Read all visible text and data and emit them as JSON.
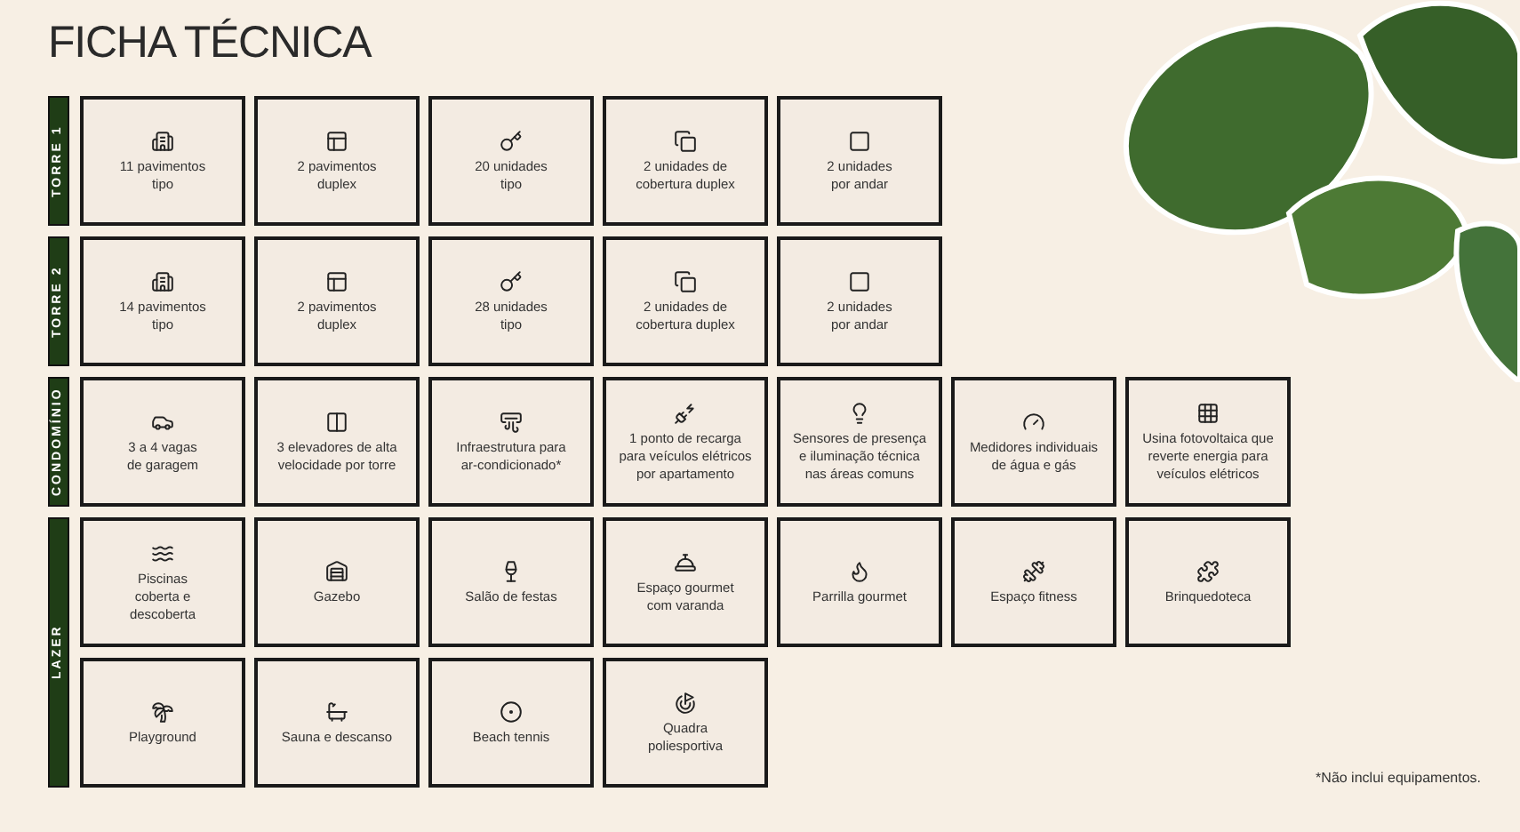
{
  "title": "FICHA TÉCNICA",
  "sections": [
    {
      "label": "TORRE 1",
      "items": [
        "11 pavimentos\ntipo",
        "2 pavimentos\nduplex",
        "20 unidades\ntipo",
        "2 unidades de\ncobertura duplex",
        "2 unidades\npor andar"
      ]
    },
    {
      "label": "TORRE 2",
      "items": [
        "14 pavimentos\ntipo",
        "2 pavimentos\nduplex",
        "28 unidades\ntipo",
        "2 unidades de\ncobertura duplex",
        "2 unidades\npor andar"
      ]
    },
    {
      "label": "CONDOMÍNIO",
      "items": [
        "3 a 4 vagas\nde garagem",
        "3 elevadores de alta\nvelocidade por torre",
        "Infraestrutura para\nar-condicionado*",
        "1 ponto de recarga\npara veículos elétricos\npor apartamento",
        "Sensores de presença\ne iluminação técnica\nnas áreas comuns",
        "Medidores individuais\nde água e gás",
        "Usina fotovoltaica que\nreverte energia para\nveículos elétricos"
      ]
    },
    {
      "label": "LAZER",
      "items": [
        "Piscinas\ncoberta e\ndescoberta",
        "Gazebo",
        "Salão de festas",
        "Espaço gourmet\ncom varanda",
        "Parrilla gourmet",
        "Espaço fitness",
        "Brinquedoteca",
        "Playground",
        "Sauna e descanso",
        "Beach tennis",
        "Quadra\npoliesportiva"
      ]
    }
  ],
  "footnote": "*Não inclui equipamentos."
}
